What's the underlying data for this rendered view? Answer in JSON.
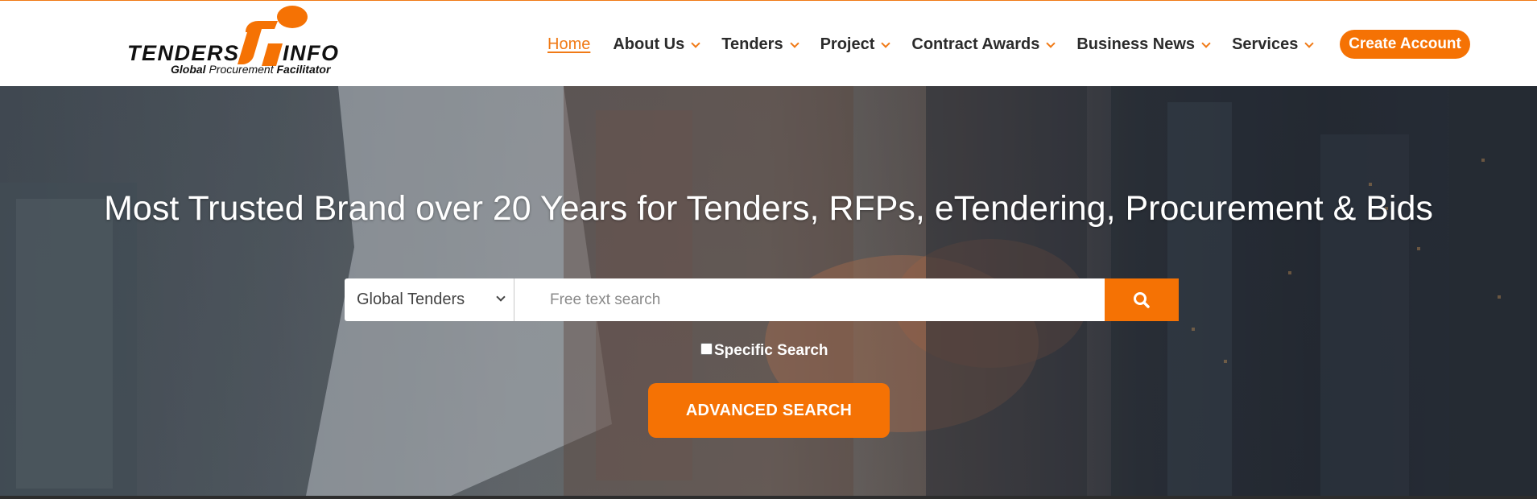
{
  "brand": {
    "word_left": "TENDERS",
    "word_right": "INFO",
    "mark": "ti",
    "tagline_bold_1": "Global",
    "tagline_mid": "Procurement",
    "tagline_bold_2": "Facilitator",
    "accent_color": "#f57204"
  },
  "nav": {
    "items": [
      {
        "label": "Home",
        "active": true,
        "dropdown": false
      },
      {
        "label": "About Us",
        "active": false,
        "dropdown": true
      },
      {
        "label": "Tenders",
        "active": false,
        "dropdown": true
      },
      {
        "label": "Project",
        "active": false,
        "dropdown": true
      },
      {
        "label": "Contract Awards",
        "active": false,
        "dropdown": true
      },
      {
        "label": "Business News",
        "active": false,
        "dropdown": true
      },
      {
        "label": "Services",
        "active": false,
        "dropdown": true
      }
    ],
    "cta_label": "Create Account"
  },
  "hero": {
    "title": "Most Trusted Brand over 20 Years for Tenders, RFPs, eTendering, Procurement & Bids",
    "category_selected": "Global Tenders",
    "search_placeholder": "Free text search",
    "search_value": "",
    "search_icon": "search-icon",
    "specific_search_label": "Specific Search",
    "specific_search_checked": false,
    "advanced_search_label": "ADVANCED SEARCH"
  }
}
